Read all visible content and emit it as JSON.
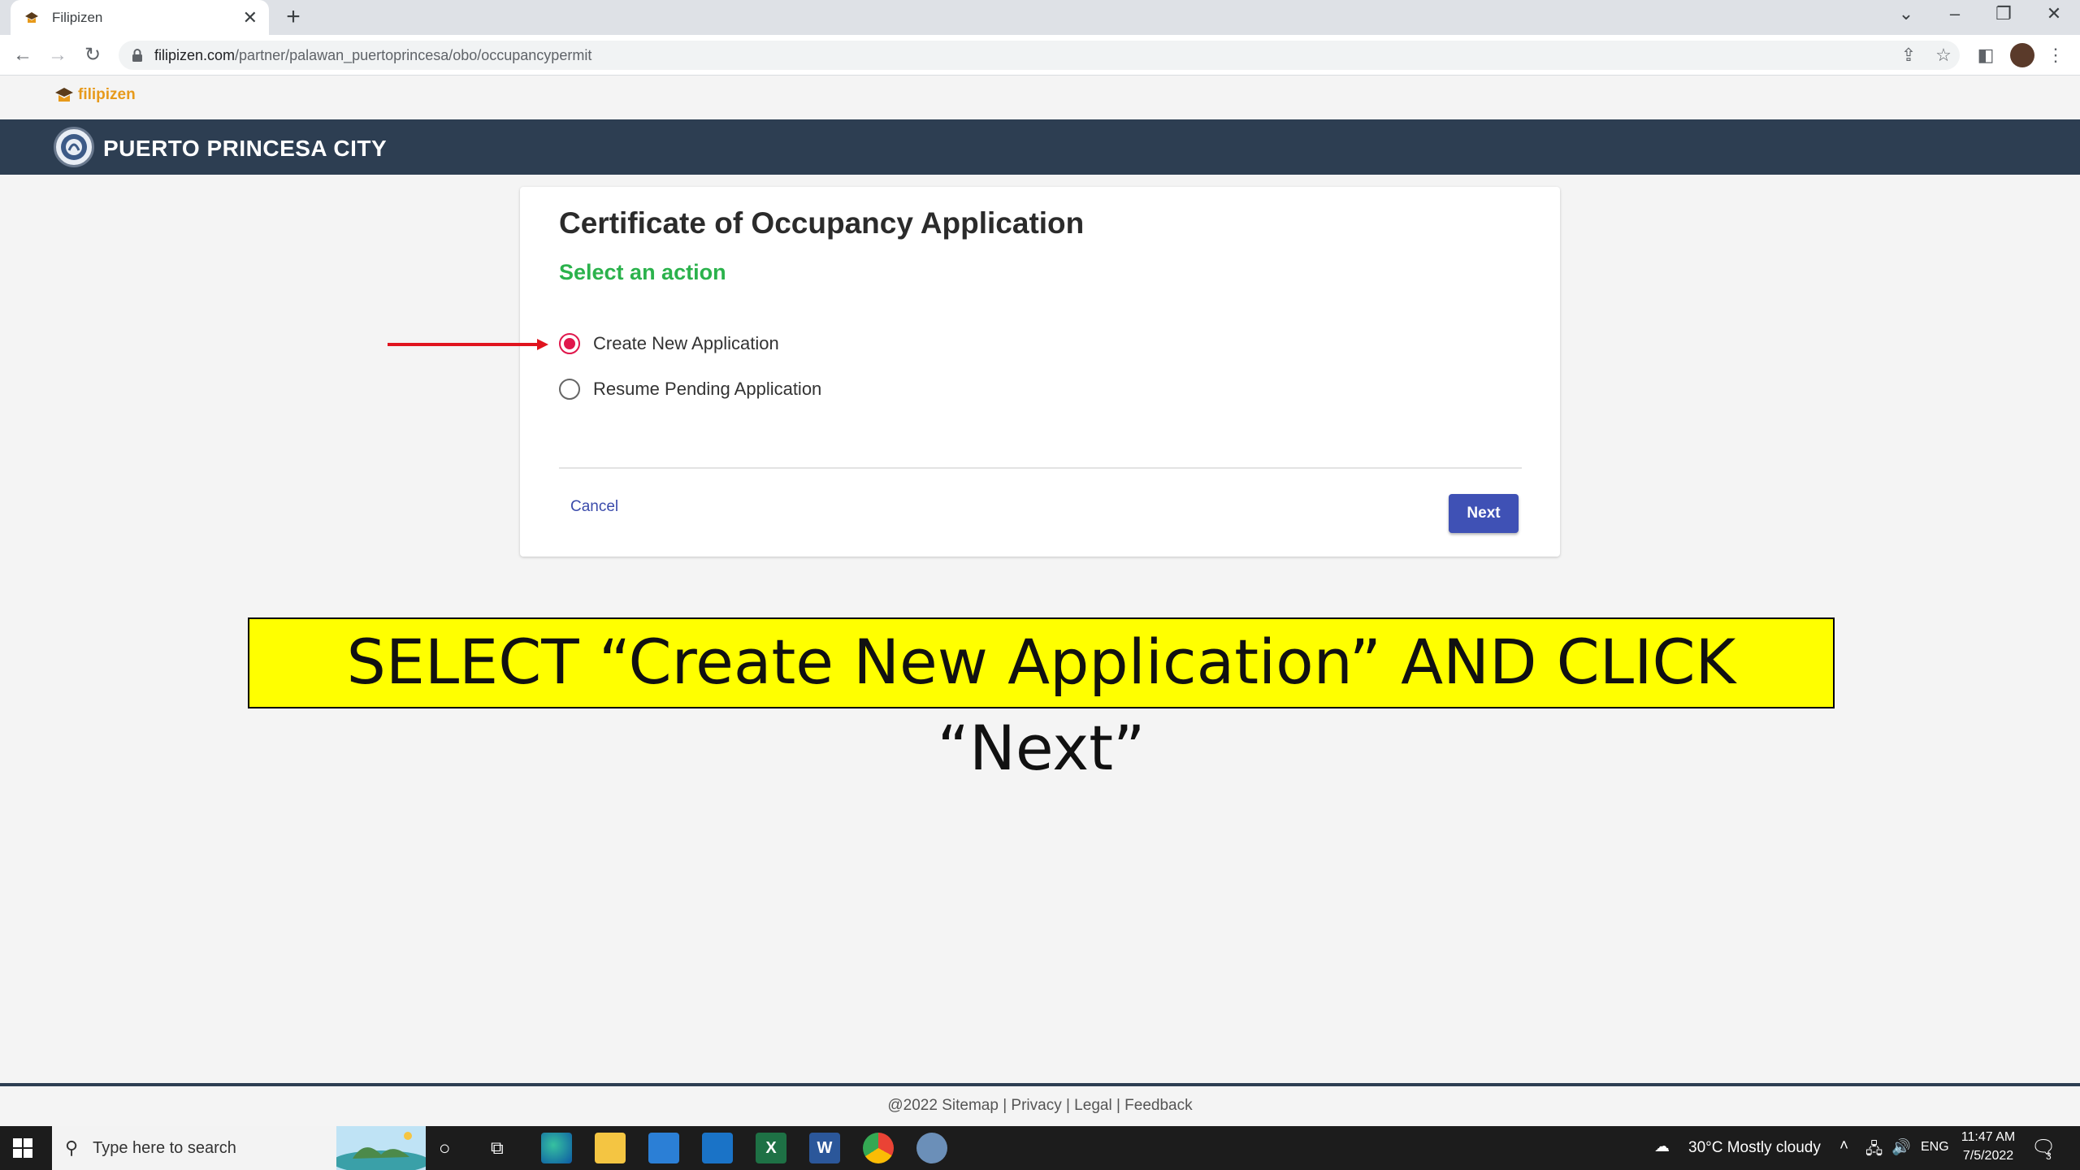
{
  "browser": {
    "tab_title": "Filipizen",
    "tab_close": "✕",
    "new_tab": "+",
    "url_host": "filipizen.com",
    "url_path": "/partner/palawan_puertoprincesa/obo/occupancypermit"
  },
  "site": {
    "brand": "filipizen",
    "city_name": "PUERTO PRINCESA CITY"
  },
  "card": {
    "title": "Certificate of Occupancy Application",
    "subtitle": "Select an action",
    "options": [
      {
        "label": "Create New Application",
        "selected": true
      },
      {
        "label": "Resume Pending Application",
        "selected": false
      }
    ],
    "cancel_label": "Cancel",
    "next_label": "Next"
  },
  "annotation": {
    "banner_text": "SELECT “Create New Application” AND CLICK “Next”",
    "arrow_color": "#e0141e"
  },
  "footer": {
    "text": "@2022 Sitemap | Privacy | Legal | Feedback"
  },
  "taskbar": {
    "search_placeholder": "Type here to search",
    "weather": "30°C  Mostly cloudy",
    "language": "ENG",
    "time": "11:47 AM",
    "date": "7/5/2022",
    "notifications": "3"
  },
  "colors": {
    "header_navy": "#2d3e52",
    "accent_green": "#2bb24c",
    "primary_button": "#3f51b5",
    "radio_selected": "#e0174c",
    "banner_yellow": "#ffff00"
  }
}
